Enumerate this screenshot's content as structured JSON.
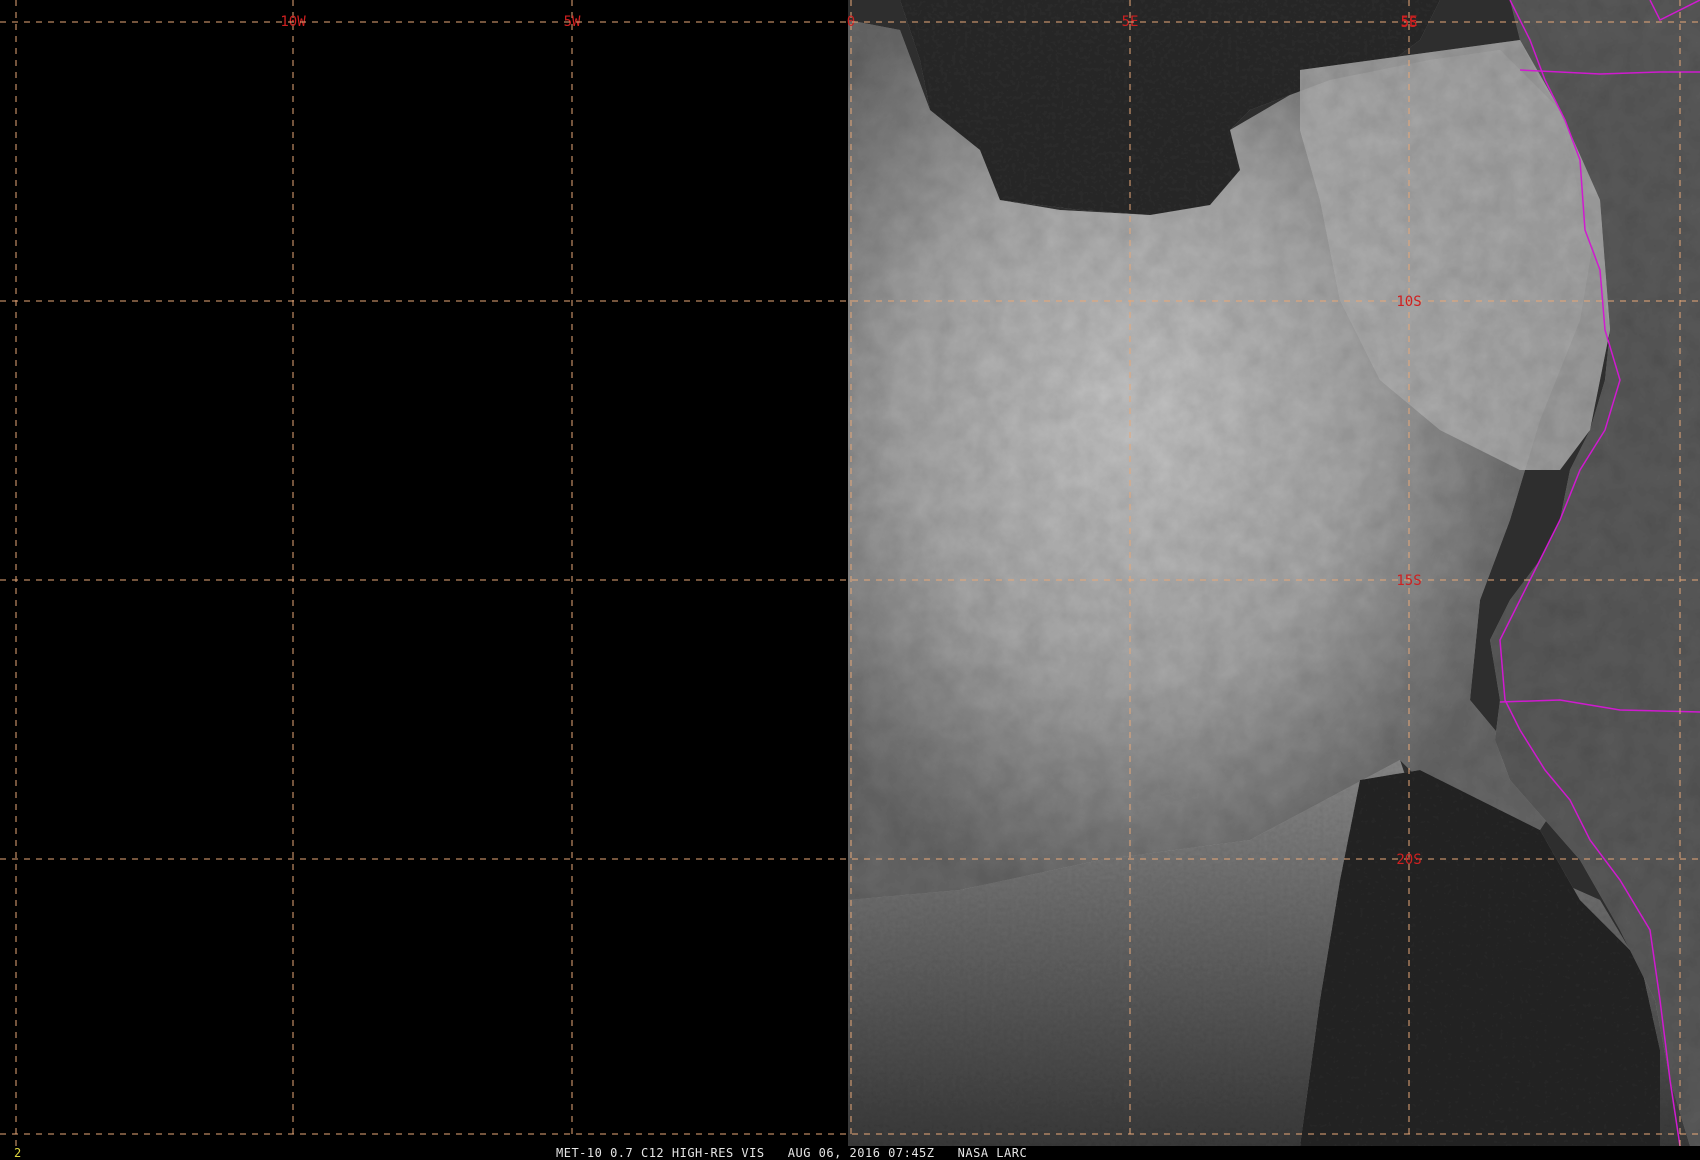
{
  "image": {
    "satellite": "MET-10",
    "product": "0.7 C12 HIGH-RES VIS",
    "date": "AUG 06, 2016",
    "time": "07:45Z",
    "source": "NASA LARC",
    "caption": "MET-10 0.7 C12 HIGH-RES VIS   AUG 06, 2016 07:45Z   NASA LARC",
    "frame_number": "2"
  },
  "map": {
    "grid": {
      "line_color": "#e8a878",
      "longitudes": [
        {
          "value": -10,
          "label": "10W"
        },
        {
          "value": -5,
          "label": "5W"
        },
        {
          "value": 0,
          "label": "0"
        },
        {
          "value": 5,
          "label": "5E"
        },
        {
          "value": 10,
          "label": "5E"
        }
      ],
      "latitudes": [
        {
          "value": -5,
          "label": "5S"
        },
        {
          "value": -10,
          "label": "10S"
        },
        {
          "value": -15,
          "label": "15S"
        },
        {
          "value": -20,
          "label": "20S"
        }
      ]
    },
    "colors": {
      "off_disk": "#000000",
      "ocean": "#2b2b2b",
      "cloud": "#bdbdbd",
      "land": "#5a5a5a",
      "coastline": "#d01ad0",
      "label": "#d02020"
    }
  }
}
